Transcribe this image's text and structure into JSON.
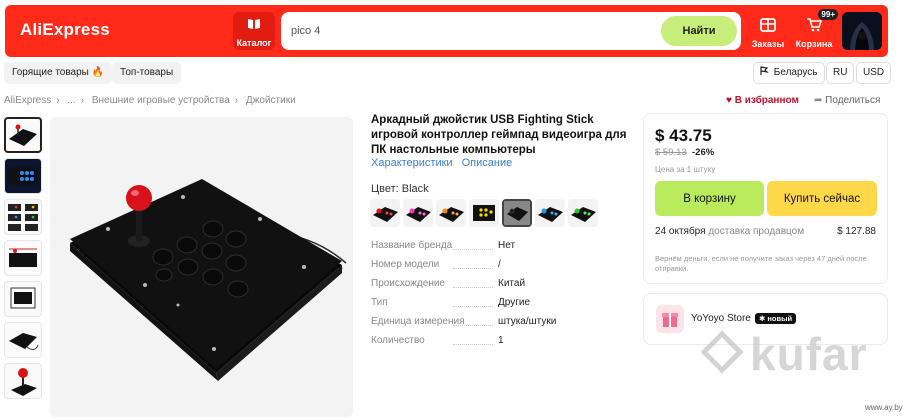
{
  "header": {
    "logo": "AliExpress",
    "catalog_label": "Каталог",
    "search_value": "pico 4",
    "search_button": "Найти",
    "orders_label": "Заказы",
    "cart_label": "Корзина",
    "cart_badge": "99+"
  },
  "subnav": {
    "chips": [
      "Горящие товары 🔥",
      "Топ-товары"
    ],
    "location": "Беларусь",
    "language": "RU",
    "currency": "USD"
  },
  "breadcrumb": [
    "AliExpress",
    "...",
    "Внешние игровые устройства",
    "Джойстики"
  ],
  "actions": {
    "favorites": "В избранном",
    "share": "Поделиться"
  },
  "product": {
    "title": "Аркадный джойстик USB Fighting Stick игровой контроллер геймпад видеоигра для ПК настольные компьютеры",
    "tabs": [
      "Характеристики",
      "Описание"
    ],
    "color_label": "Цвет: Black",
    "specs": [
      {
        "key": "Название бренда",
        "value": "Нет"
      },
      {
        "key": "Номер модели",
        "value": "/"
      },
      {
        "key": "Происхождение",
        "value": "Китай"
      },
      {
        "key": "Тип",
        "value": "Другие"
      },
      {
        "key": "Единица измерения",
        "value": "штука/штуки"
      },
      {
        "key": "Количество",
        "value": "1"
      }
    ]
  },
  "buy": {
    "price": "$ 43.75",
    "old_price": "$ 59.13",
    "discount": "-26%",
    "unit_note": "Цена за 1 штуку",
    "cart_button": "В корзину",
    "buy_button": "Купить сейчас",
    "delivery_date": "24 октября",
    "delivery_text": "доставка продавцом",
    "delivery_price": "$ 127.88",
    "refund_note": "Вернём деньги, если не получите заказ через 47 дней после отправки."
  },
  "store": {
    "name": "YoYoyo Store",
    "badge": "✱ новый"
  },
  "watermark": {
    "brand": "kufar",
    "url": "www.ay.by"
  },
  "colors": {
    "brand_red": "#ff2a1a",
    "search_green": "#c7ee7a",
    "cart_green": "#b9eb5c",
    "buy_yellow": "#ffd84a",
    "link_blue": "#3a7fd0",
    "fav_red": "#c8102e"
  }
}
